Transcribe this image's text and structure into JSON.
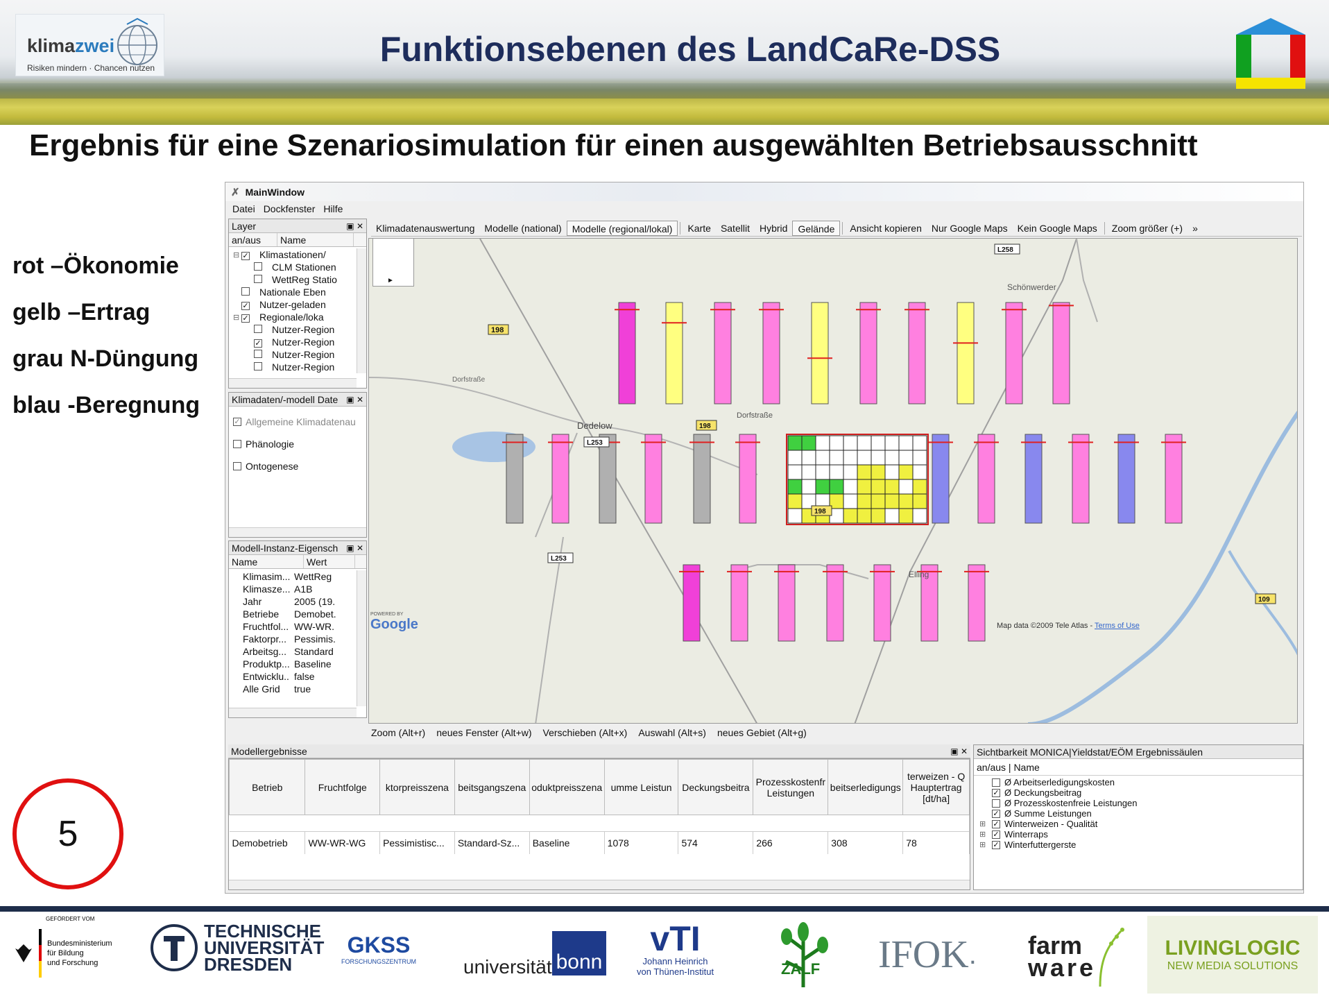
{
  "slide": {
    "title": "Funktionsebenen des LandCaRe-DSS",
    "subtitle": "Ergebnis für eine Szenariosimulation für einen ausgewählten Betriebsausschnitt",
    "logo_name_1": "klima",
    "logo_name_2": "zwei",
    "logo_tagline": "Risiken mindern · Chancen nutzen",
    "legend": [
      "rot –Ökonomie",
      "gelb –Ertrag",
      "grau N-Düngung",
      "blau -Beregnung"
    ],
    "page_number": "5"
  },
  "window": {
    "title": "MainWindow",
    "menu": [
      "Datei",
      "Dockfenster",
      "Hilfe"
    ]
  },
  "layer_panel": {
    "title": "Layer",
    "col_on": "an/aus",
    "col_name": "Name",
    "rows": [
      {
        "label": "Klimastationen/",
        "checked": true,
        "level": 0,
        "expander": "⊟"
      },
      {
        "label": "CLM Stationen",
        "checked": false,
        "level": 1,
        "expander": ""
      },
      {
        "label": "WettReg Statio",
        "checked": false,
        "level": 1,
        "expander": ""
      },
      {
        "label": "Nationale Eben",
        "checked": false,
        "level": 0,
        "expander": ""
      },
      {
        "label": "Nutzer-geladen",
        "checked": true,
        "level": 0,
        "expander": ""
      },
      {
        "label": "Regionale/loka",
        "checked": true,
        "level": 0,
        "expander": "⊟"
      },
      {
        "label": "Nutzer-Region",
        "checked": false,
        "level": 1,
        "expander": ""
      },
      {
        "label": "Nutzer-Region",
        "checked": true,
        "level": 1,
        "expander": ""
      },
      {
        "label": "Nutzer-Region",
        "checked": false,
        "level": 1,
        "expander": ""
      },
      {
        "label": "Nutzer-Region",
        "checked": false,
        "level": 1,
        "expander": ""
      }
    ]
  },
  "klima_panel": {
    "title": "Klimadaten/-modell Date",
    "items": [
      {
        "label": "Allgemeine Klimadatenau",
        "checked": true,
        "disabled": true
      },
      {
        "label": "Phänologie",
        "checked": false,
        "disabled": false
      },
      {
        "label": "Ontogenese",
        "checked": false,
        "disabled": false
      }
    ]
  },
  "props_panel": {
    "title": "Modell-Instanz-Eigensch",
    "col_name": "Name",
    "col_value": "Wert",
    "rows": [
      {
        "name": "Klimasim...",
        "value": "WettReg"
      },
      {
        "name": "Klimasze...",
        "value": "A1B"
      },
      {
        "name": "Jahr",
        "value": "2005 (19."
      },
      {
        "name": "Betriebe",
        "value": "Demobet."
      },
      {
        "name": "Fruchtfol...",
        "value": "WW-WR."
      },
      {
        "name": "Faktorpr...",
        "value": "Pessimis."
      },
      {
        "name": "Arbeitsg...",
        "value": "Standard"
      },
      {
        "name": "Produktp...",
        "value": "Baseline"
      },
      {
        "name": "Entwicklu...",
        "value": "false"
      },
      {
        "name": "Alle Grid",
        "value": "true"
      }
    ]
  },
  "toolbar": {
    "tabs": [
      "Klimadatenauswertung",
      "Modelle (national)",
      "Modelle (regional/lokal)"
    ],
    "map_buttons": [
      "Karte",
      "Satellit",
      "Hybrid",
      "Gelände"
    ],
    "actions": [
      "Ansicht kopieren",
      "Nur Google Maps",
      "Kein Google Maps"
    ],
    "zoom": "Zoom größer (+)",
    "more": "»"
  },
  "map": {
    "labels": {
      "schoenwerder": "Schönwerder",
      "dedelow": "Dedelow",
      "dorfstrasse": "Dorfstraße",
      "dorfstrasse2": "Dorfstraße",
      "elling": "Elling",
      "r198a": "198",
      "r198b": "198",
      "r198c": "198",
      "l253a": "L253",
      "l253b": "L253",
      "l258": "L258",
      "r109": "109"
    },
    "powered_by": "POWERED BY",
    "google": "Google",
    "copyright": "Map data ©2009 Tele Atlas - ",
    "terms": "Terms of Use",
    "colors": {
      "rot": "#ff80e0",
      "rot_dark": "#f040d8",
      "gelb": "#ffff80",
      "grau": "#b0b0b0",
      "blau": "#8888ee",
      "red_line": "#e02020",
      "grid_green": "#40d040",
      "grid_yellow": "#f0f040"
    },
    "row1_bars": [
      "magenta",
      "yellow",
      "pink",
      "pink",
      "yellow",
      "pink",
      "pink",
      "yellow",
      "pink",
      "pink"
    ],
    "row2_bars": [
      "gray",
      "pink",
      "gray",
      "pink",
      "gray",
      "pink",
      "blue",
      "pink",
      "blue",
      "pink",
      "blue",
      "pink"
    ],
    "row3_bars": [
      "magenta",
      "pink",
      "pink",
      "pink",
      "pink",
      "pink",
      "pink"
    ]
  },
  "bottom_toolbar": [
    "Zoom (Alt+r)",
    "neues Fenster (Alt+w)",
    "Verschieben (Alt+x)",
    "Auswahl (Alt+s)",
    "neues Gebiet (Alt+g)"
  ],
  "results_panel": {
    "title": "Modellergebnisse",
    "headers": [
      "Betrieb",
      "Fruchtfolge",
      "ktorpreisszena",
      "beitsgangszena",
      "oduktpreisszena",
      "umme Leistun",
      "Deckungsbeitra",
      "Prozesskostenfr Leistungen",
      "beitserledigungs",
      "terweizen - Q Hauptertrag [dt/ha]"
    ],
    "rows": [
      [
        "Demobetrieb",
        "WW-WR-WG",
        "Pessimistisc...",
        "Standard-Sz...",
        "Baseline",
        "1078",
        "574",
        "266",
        "308",
        "78"
      ]
    ]
  },
  "visibility_panel": {
    "title": "Sichtbarkeit MONICA|Yieldstat/EÖM Ergebnissäulen",
    "header": "an/aus | Name",
    "items": [
      {
        "label": "Ø Arbeitserledigungskosten",
        "checked": false,
        "expander": ""
      },
      {
        "label": "Ø Deckungsbeitrag",
        "checked": true,
        "expander": ""
      },
      {
        "label": "Ø Prozesskostenfreie Leistungen",
        "checked": false,
        "expander": ""
      },
      {
        "label": "Ø Summe Leistungen",
        "checked": true,
        "expander": ""
      },
      {
        "label": "Winterweizen - Qualität",
        "checked": true,
        "expander": "⊞"
      },
      {
        "label": "Winterraps",
        "checked": true,
        "expander": "⊞"
      },
      {
        "label": "Winterfuttergerste",
        "checked": true,
        "expander": "⊞"
      }
    ]
  },
  "footer": {
    "bmbf_top": "GEFÖRDERT VOM",
    "bmbf": [
      "Bundesministerium",
      "für Bildung",
      "und Forschung"
    ],
    "tud": [
      "TECHNISCHE",
      "UNIVERSITÄT",
      "DRESDEN"
    ],
    "gkss": "GKSS",
    "gkss_sub": "FORSCHUNGSZENTRUM",
    "bonn_1": "universität",
    "bonn_2": "bonn",
    "vti": "vTI",
    "vti_sub": [
      "Johann Heinrich",
      "von Thünen-Institut"
    ],
    "zalf": "ZALF",
    "ifok": "IFOK",
    "ifok_dot": ".",
    "farmware_1": "farm",
    "farmware_2": "ware",
    "livinglogic_1": "LIVINGLOGIC",
    "livinglogic_2": "NEW MEDIA SOLUTIONS"
  }
}
